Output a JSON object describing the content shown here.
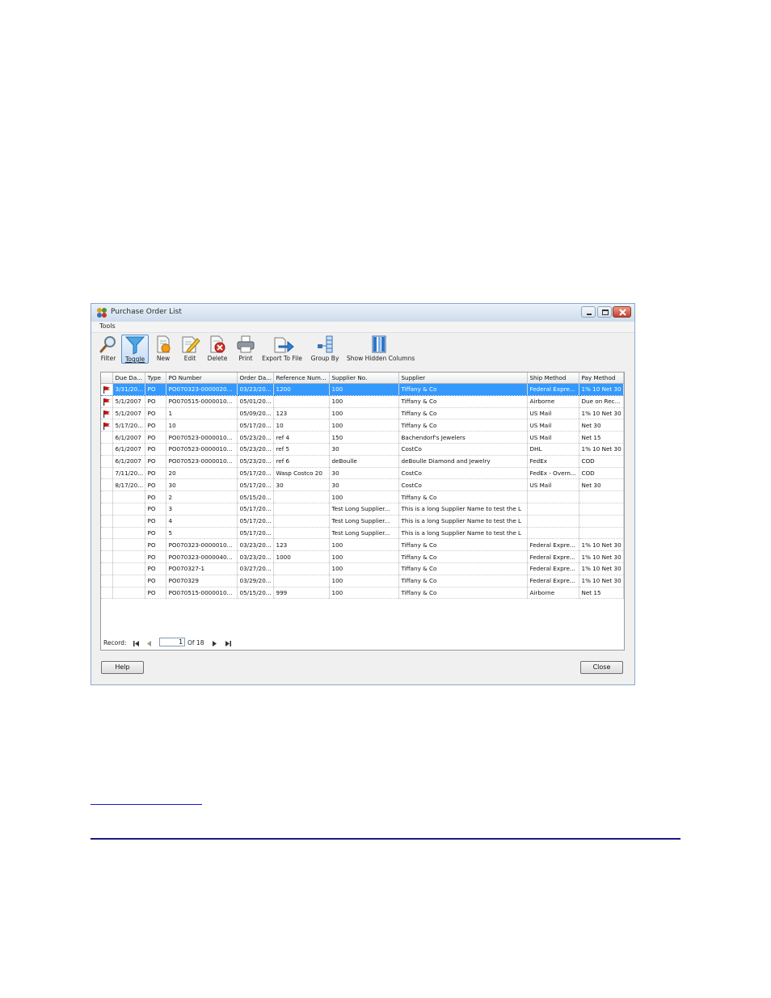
{
  "window": {
    "title": "Purchase Order List",
    "menu": [
      "Tools"
    ]
  },
  "toolbar": {
    "items": [
      {
        "id": "filter",
        "label": "Filter",
        "icon": "magnifier-icon"
      },
      {
        "id": "toggle",
        "label": "Toggle",
        "icon": "funnel-icon",
        "pressed": true
      },
      {
        "id": "new",
        "label": "New",
        "icon": "new-document-icon"
      },
      {
        "id": "edit",
        "label": "Edit",
        "icon": "edit-document-icon"
      },
      {
        "id": "delete",
        "label": "Delete",
        "icon": "delete-document-icon"
      },
      {
        "id": "print",
        "label": "Print",
        "icon": "printer-icon"
      },
      {
        "id": "export",
        "label": "Export To File",
        "icon": "export-icon"
      },
      {
        "id": "groupby",
        "label": "Group By",
        "icon": "group-by-icon"
      },
      {
        "id": "showhidden",
        "label": "Show Hidden Columns",
        "icon": "columns-icon"
      }
    ]
  },
  "grid": {
    "columns": [
      "",
      "Due Da...",
      "Type",
      "PO Number",
      "Order Da...",
      "Reference Num...",
      "Supplier No.",
      "Supplier",
      "Ship Method",
      "Pay Method"
    ],
    "rows": [
      {
        "flag": true,
        "selected": true,
        "cells": [
          "3/31/20...",
          "PO",
          "PO070323-0000020...",
          "03/23/20...",
          "1200",
          "100",
          "Tiffany & Co",
          "Federal Expre...",
          "1% 10 Net 30"
        ]
      },
      {
        "flag": true,
        "cells": [
          "5/1/2007",
          "PO",
          "PO070515-0000010...",
          "05/01/20...",
          "",
          "100",
          "Tiffany & Co",
          "Airborne",
          "Due on Rec..."
        ]
      },
      {
        "flag": true,
        "cells": [
          "5/1/2007",
          "PO",
          "1",
          "05/09/20...",
          "123",
          "100",
          "Tiffany & Co",
          "US Mail",
          "1% 10 Net 30"
        ]
      },
      {
        "flag": true,
        "cells": [
          "5/17/20...",
          "PO",
          "10",
          "05/17/20...",
          "10",
          "100",
          "Tiffany & Co",
          "US Mail",
          "Net 30"
        ]
      },
      {
        "cells": [
          "6/1/2007",
          "PO",
          "PO070523-0000010...",
          "05/23/20...",
          "ref 4",
          "150",
          "Bachendorf's Jewelers",
          "US Mail",
          "Net 15"
        ]
      },
      {
        "cells": [
          "6/1/2007",
          "PO",
          "PO070523-0000010...",
          "05/23/20...",
          "ref 5",
          "30",
          "CostCo",
          "DHL",
          "1% 10 Net 30"
        ]
      },
      {
        "cells": [
          "6/1/2007",
          "PO",
          "PO070523-0000010...",
          "05/23/20...",
          "ref 6",
          "deBoulle",
          "deBoulle Diamond and Jewelry",
          "FedEx",
          "COD"
        ]
      },
      {
        "cells": [
          "7/11/20...",
          "PO",
          "20",
          "05/17/20...",
          "Wasp Costco 20",
          "30",
          "CostCo",
          "FedEx - Overn...",
          "COD"
        ]
      },
      {
        "cells": [
          "8/17/20...",
          "PO",
          "30",
          "05/17/20...",
          "30",
          "30",
          "CostCo",
          "US Mail",
          "Net 30"
        ]
      },
      {
        "cells": [
          "",
          "PO",
          "2",
          "05/15/20...",
          "",
          "100",
          "Tiffany & Co",
          "",
          ""
        ]
      },
      {
        "cells": [
          "",
          "PO",
          "3",
          "05/17/20...",
          "",
          "Test Long Supplier...",
          "This is a long Supplier Name to test the L",
          "",
          ""
        ]
      },
      {
        "cells": [
          "",
          "PO",
          "4",
          "05/17/20...",
          "",
          "Test Long Supplier...",
          "This is a long Supplier Name to test the L",
          "",
          ""
        ]
      },
      {
        "cells": [
          "",
          "PO",
          "5",
          "05/17/20...",
          "",
          "Test Long Supplier...",
          "This is a long Supplier Name to test the L",
          "",
          ""
        ]
      },
      {
        "cells": [
          "",
          "PO",
          "PO070323-0000010...",
          "03/23/20...",
          "123",
          "100",
          "Tiffany & Co",
          "Federal Expre...",
          "1% 10 Net 30"
        ]
      },
      {
        "cells": [
          "",
          "PO",
          "PO070323-0000040...",
          "03/23/20...",
          "1000",
          "100",
          "Tiffany & Co",
          "Federal Expre...",
          "1% 10 Net 30"
        ]
      },
      {
        "cells": [
          "",
          "PO",
          "PO070327-1",
          "03/27/20...",
          "",
          "100",
          "Tiffany & Co",
          "Federal Expre...",
          "1% 10 Net 30"
        ]
      },
      {
        "cells": [
          "",
          "PO",
          "PO070329",
          "03/29/20...",
          "",
          "100",
          "Tiffany & Co",
          "Federal Expre...",
          "1% 10 Net 30"
        ]
      },
      {
        "cells": [
          "",
          "PO",
          "PO070515-0000010...",
          "05/15/20...",
          "999",
          "100",
          "Tiffany & Co",
          "Airborne",
          "Net 15"
        ]
      }
    ]
  },
  "navigator": {
    "label": "Record:",
    "current": "1",
    "of_text": "Of  18"
  },
  "buttons": {
    "help": "Help",
    "close": "Close"
  },
  "colors": {
    "selection": "#3399ff",
    "flag": "#cc1111"
  }
}
